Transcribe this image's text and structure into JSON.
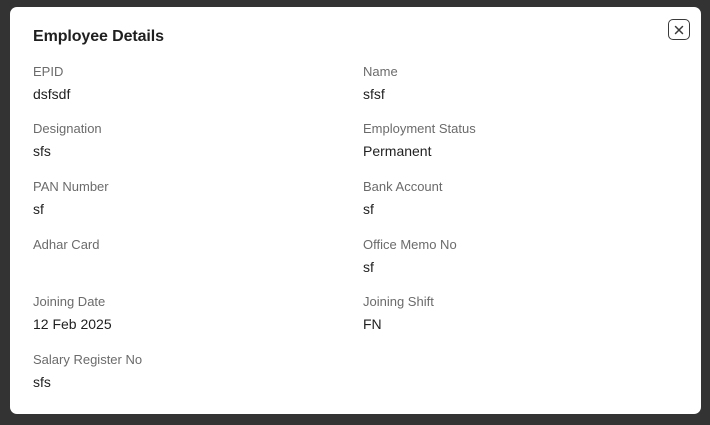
{
  "dialog": {
    "title": "Employee Details",
    "close_icon": "close-icon"
  },
  "fields": {
    "epid": {
      "label": "EPID",
      "value": "dsfsdf"
    },
    "name": {
      "label": "Name",
      "value": "sfsf"
    },
    "designation": {
      "label": "Designation",
      "value": "sfs"
    },
    "employment_status": {
      "label": "Employment Status",
      "value": "Permanent"
    },
    "pan_number": {
      "label": "PAN Number",
      "value": "sf"
    },
    "bank_account": {
      "label": "Bank Account",
      "value": "sf"
    },
    "adhar_card": {
      "label": "Adhar Card",
      "value": ""
    },
    "office_memo_no": {
      "label": "Office Memo No",
      "value": "sf"
    },
    "joining_date": {
      "label": "Joining Date",
      "value": "12 Feb 2025"
    },
    "joining_shift": {
      "label": "Joining Shift",
      "value": "FN"
    },
    "salary_register_no": {
      "label": "Salary Register No",
      "value": "sfs"
    }
  }
}
